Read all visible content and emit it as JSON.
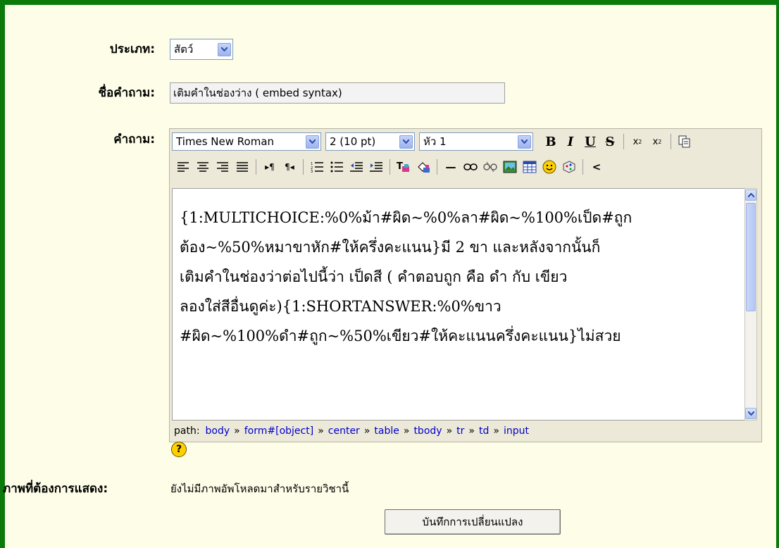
{
  "form": {
    "category_label": "ประเภท:",
    "category_value": "สัตว์",
    "question_name_label": "ชื่อคำถาม:",
    "question_name_value": "เติมคำในช่องว่าง ( embed syntax)",
    "question_label": "คำถาม:",
    "image_label": "ภาพที่ต้องการแสดง:",
    "image_value": "ยังไม่มีภาพอัพโหลดมาสำหรับรายวิชานี้",
    "save_label": "บันทึกการเปลี่ยนแปลง"
  },
  "editor": {
    "font_family": "Times New Roman",
    "font_size": "2 (10 pt)",
    "heading": "หัว 1",
    "content_lines": [
      "{1:MULTICHOICE:%0%ม้า#ผิด~%0%ลา#ผิด~%100%เป็ด#ถูก",
      "ต้อง~%50%หมาขาหัก#ให้ครึ่งคะแนน}มี 2 ขา และหลังจากนั้นก็",
      "เติมคำในช่องว่าต่อไปนี้ว่า  เป็ดสี ( คำตอบถูก คือ ดำ กับ เขียว",
      "ลองใส่สีอื่นดูค่ะ){1:SHORTANSWER:%0%ขาว",
      "#ผิด~%100%ดำ#ถูก~%50%เขียว#ให้คะแนนครึ่งคะแนน}ไม่สวย"
    ],
    "path_label": "path:",
    "path_items": [
      "body",
      "form#[object]",
      "center",
      "table",
      "tbody",
      "tr",
      "td",
      "input"
    ],
    "help": "?"
  },
  "colors": {
    "frame": "#0a7a0a",
    "background": "#fdfde8",
    "link": "#0000cc"
  }
}
